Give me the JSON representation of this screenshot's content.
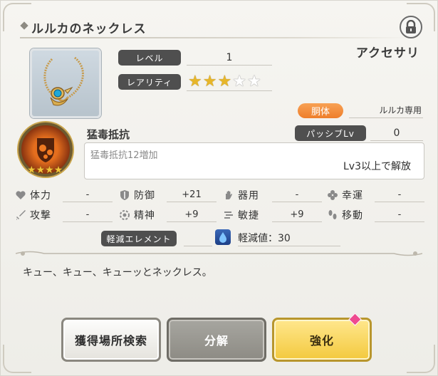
{
  "item": {
    "name": "ルルカのネックレス",
    "category": "アクセサリ",
    "level_label": "レベル",
    "level_value": "1",
    "rarity_label": "レアリティ",
    "rarity_stars": 3,
    "rarity_max": 5,
    "character_badge": "胴体",
    "character_exclusive": "ルルカ専用",
    "flavor": "キュー、キュー、キューッとネックレス。"
  },
  "skill": {
    "name": "猛毒抵抗",
    "passive_label": "パッシブLv",
    "passive_value": "0",
    "description": "猛毒抵抗12増加",
    "unlock": "Lv3以上で解放",
    "stars": 4
  },
  "stats": [
    {
      "label": "体力",
      "value": "-",
      "icon": "heart-icon"
    },
    {
      "label": "防御",
      "value": "+21",
      "icon": "shield-icon"
    },
    {
      "label": "器用",
      "value": "-",
      "icon": "hand-icon"
    },
    {
      "label": "幸運",
      "value": "-",
      "icon": "clover-icon"
    },
    {
      "label": "攻撃",
      "value": "-",
      "icon": "sword-icon"
    },
    {
      "label": "精神",
      "value": "+9",
      "icon": "spirit-icon"
    },
    {
      "label": "敏捷",
      "value": "+9",
      "icon": "wind-icon"
    },
    {
      "label": "移動",
      "value": "-",
      "icon": "footprint-icon"
    }
  ],
  "element": {
    "label": "軽減エレメント",
    "reduction": "軽減値：30",
    "icon": "water-drop-icon",
    "color": "#2b56a6"
  },
  "buttons": {
    "search": "獲得場所検索",
    "decompose": "分解",
    "enhance": "強化"
  },
  "colors": {
    "accent_orange": "#f08a36",
    "star_gold": "#e7b62a",
    "enhance_yellow": "#f6d250",
    "notify_pink": "#ee4a90"
  }
}
